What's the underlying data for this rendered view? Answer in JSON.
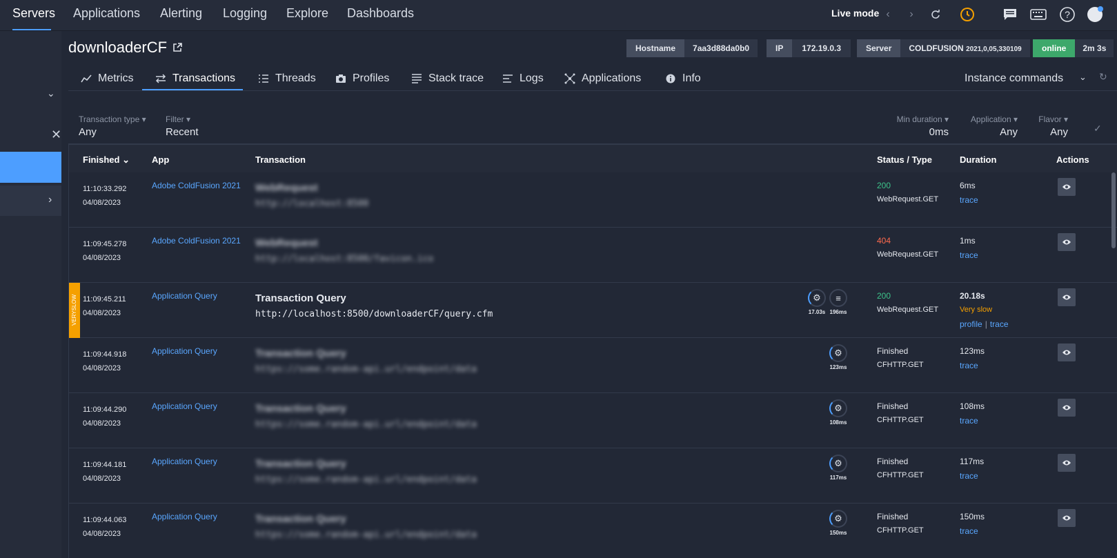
{
  "nav": {
    "items": [
      "Servers",
      "Applications",
      "Alerting",
      "Logging",
      "Explore",
      "Dashboards"
    ],
    "live_mode": "Live mode"
  },
  "server": {
    "name": "downloaderCF",
    "hostname_label": "Hostname",
    "hostname": "7aa3d88da0b0",
    "ip_label": "IP",
    "ip": "172.19.0.3",
    "server_label": "Server",
    "server_value": "COLDFUSION",
    "server_version": "2021,0,05,330109",
    "status": "online",
    "uptime": "2m 3s"
  },
  "tabs": [
    "Metrics",
    "Transactions",
    "Threads",
    "Profiles",
    "Stack trace",
    "Logs",
    "Applications",
    "Info"
  ],
  "instance_commands": "Instance commands",
  "filters": {
    "transaction_type": {
      "label": "Transaction type",
      "value": "Any"
    },
    "filter": {
      "label": "Filter",
      "value": "Recent"
    },
    "min_duration": {
      "label": "Min duration",
      "value": "0ms"
    },
    "application": {
      "label": "Application",
      "value": "Any"
    },
    "flavor": {
      "label": "Flavor",
      "value": "Any"
    }
  },
  "table": {
    "headers": {
      "finished": "Finished",
      "app": "App",
      "transaction": "Transaction",
      "status": "Status / Type",
      "duration": "Duration",
      "actions": "Actions"
    },
    "rows": [
      {
        "time": "11:10:33.292",
        "date": "04/08/2023",
        "app": "Adobe ColdFusion 2021",
        "title": "WebRequest",
        "url": "http://localhost:8500",
        "code": "200",
        "type": "WebRequest.GET",
        "duration": "6ms",
        "trace": "trace"
      },
      {
        "time": "11:09:45.278",
        "date": "04/08/2023",
        "app": "Adobe ColdFusion 2021",
        "title": "WebRequest",
        "url": "http://localhost:8500/favicon.ico",
        "code": "404",
        "type": "WebRequest.GET",
        "duration": "1ms",
        "trace": "trace"
      },
      {
        "time": "11:09:45.211",
        "date": "04/08/2023",
        "app": "Application Query",
        "title": "Transaction Query",
        "url": "http://localhost:8500/downloaderCF/query.cfm",
        "code": "200",
        "type": "WebRequest.GET",
        "duration": "20.18s",
        "slow": "Very slow",
        "profile": "profile",
        "trace": "trace",
        "flag": "VERYSLOW",
        "badge1": "17.03s",
        "badge2": "196ms"
      },
      {
        "time": "11:09:44.918",
        "date": "04/08/2023",
        "app": "Application Query",
        "title": "Transaction Query",
        "url": "https://some.random-api.url/endpoint/data",
        "code": "Finished",
        "type": "CFHTTP.GET",
        "duration": "123ms",
        "trace": "trace",
        "badge1": "123ms"
      },
      {
        "time": "11:09:44.290",
        "date": "04/08/2023",
        "app": "Application Query",
        "title": "Transaction Query",
        "url": "https://some.random-api.url/endpoint/data",
        "code": "Finished",
        "type": "CFHTTP.GET",
        "duration": "108ms",
        "trace": "trace",
        "badge1": "108ms"
      },
      {
        "time": "11:09:44.181",
        "date": "04/08/2023",
        "app": "Application Query",
        "title": "Transaction Query",
        "url": "https://some.random-api.url/endpoint/data",
        "code": "Finished",
        "type": "CFHTTP.GET",
        "duration": "117ms",
        "trace": "trace",
        "badge1": "117ms"
      },
      {
        "time": "11:09:44.063",
        "date": "04/08/2023",
        "app": "Application Query",
        "title": "Transaction Query",
        "url": "https://some.random-api.url/endpoint/data",
        "code": "Finished",
        "type": "CFHTTP.GET",
        "duration": "150ms",
        "trace": "trace",
        "badge1": "150ms"
      }
    ]
  },
  "colors": {
    "accent": "#4d9eff",
    "ok": "#3dc38a",
    "error": "#ff6a4d",
    "warning": "#f5a000",
    "online": "#3da86b"
  }
}
